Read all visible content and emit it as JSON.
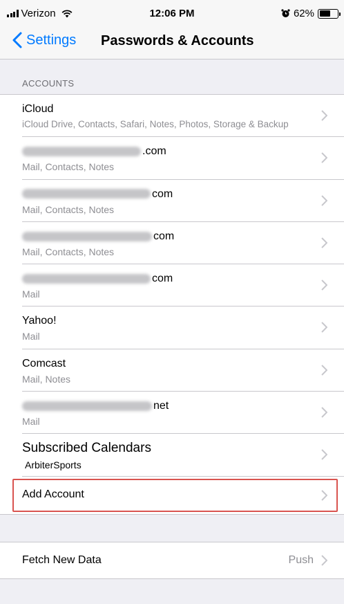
{
  "status_bar": {
    "carrier": "Verizon",
    "time": "12:06 PM",
    "battery_percent": "62%",
    "battery_level": 0.62
  },
  "nav": {
    "back_label": "Settings",
    "title": "Passwords & Accounts"
  },
  "accounts_header": "ACCOUNTS",
  "accounts": [
    {
      "title": "iCloud",
      "subtitle": "iCloud Drive, Contacts, Safari, Notes, Photos, Storage & Backup"
    },
    {
      "title": ".com",
      "subtitle": "Mail, Contacts, Notes"
    },
    {
      "title": "com",
      "subtitle": "Mail, Contacts, Notes"
    },
    {
      "title": "com",
      "subtitle": "Mail, Contacts, Notes"
    },
    {
      "title": "com",
      "subtitle": "Mail"
    },
    {
      "title": "Yahoo!",
      "subtitle": "Mail"
    },
    {
      "title": "Comcast",
      "subtitle": "Mail, Notes"
    },
    {
      "title": "net",
      "subtitle": "Mail"
    },
    {
      "title": "Subscribed Calendars",
      "subtitle": "ArbiterSports"
    },
    {
      "title": "Add Account"
    }
  ],
  "fetch": {
    "label": "Fetch New Data",
    "value": "Push"
  },
  "colors": {
    "accent": "#007aff",
    "highlight": "#d9534f",
    "background": "#efeff4"
  }
}
